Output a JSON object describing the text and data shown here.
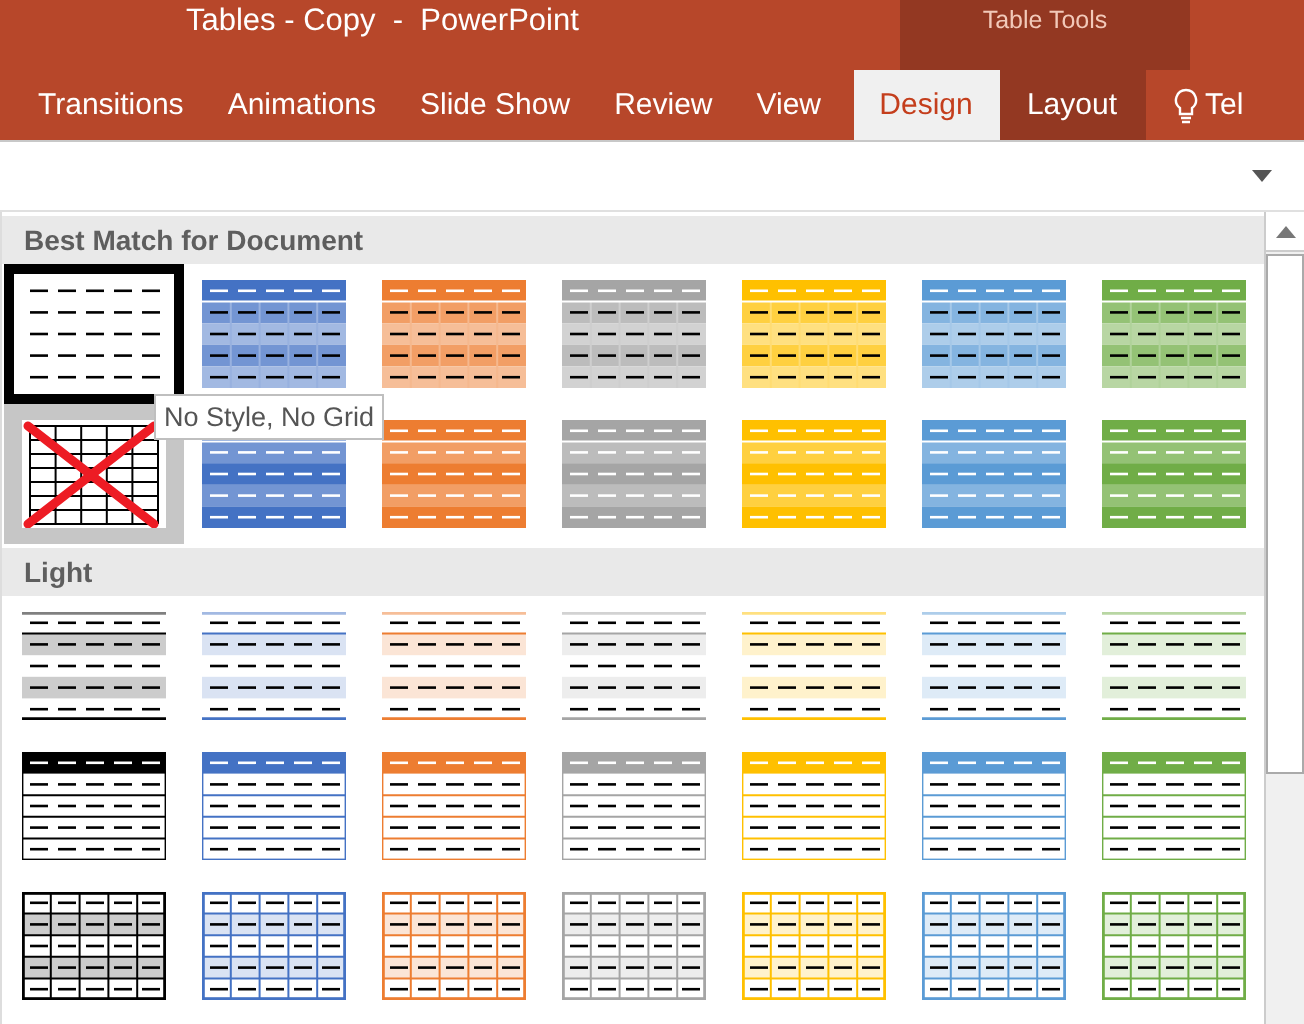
{
  "window": {
    "title": "Tables - Copy  -  PowerPoint"
  },
  "contextual_group": {
    "label": "Table Tools"
  },
  "tabs": [
    {
      "label": "Transitions",
      "selected": false,
      "contextual": false
    },
    {
      "label": "Animations",
      "selected": false,
      "contextual": false
    },
    {
      "label": "Slide Show",
      "selected": false,
      "contextual": false
    },
    {
      "label": "Review",
      "selected": false,
      "contextual": false
    },
    {
      "label": "View",
      "selected": false,
      "contextual": false
    },
    {
      "label": "Design",
      "selected": true,
      "contextual": true
    },
    {
      "label": "Layout",
      "selected": false,
      "contextual": true
    }
  ],
  "tell_me": {
    "label": "Tel"
  },
  "gallery": {
    "tooltip": "No Style, No Grid",
    "sections": [
      {
        "title": "Best Match for Document",
        "rows": [
          {
            "tiles": [
              {
                "kind": "plain",
                "selected": true
              },
              {
                "kind": "medium-grid",
                "color": "#4472c4",
                "selected": false
              },
              {
                "kind": "medium-grid",
                "color": "#ed7d31",
                "selected": false
              },
              {
                "kind": "medium-grid",
                "color": "#a5a5a5",
                "selected": false
              },
              {
                "kind": "medium-grid",
                "color": "#ffc000",
                "selected": false
              },
              {
                "kind": "medium-grid",
                "color": "#5b9bd5",
                "selected": false
              },
              {
                "kind": "medium-grid",
                "color": "#70ad47",
                "selected": false
              }
            ]
          },
          {
            "tiles": [
              {
                "kind": "clear",
                "selected": false
              },
              {
                "kind": "medium-band",
                "color": "#4472c4",
                "selected": false
              },
              {
                "kind": "medium-band",
                "color": "#ed7d31",
                "selected": false
              },
              {
                "kind": "medium-band",
                "color": "#a5a5a5",
                "selected": false
              },
              {
                "kind": "medium-band",
                "color": "#ffc000",
                "selected": false
              },
              {
                "kind": "medium-band",
                "color": "#5b9bd5",
                "selected": false
              },
              {
                "kind": "medium-band",
                "color": "#70ad47",
                "selected": false
              }
            ]
          }
        ]
      },
      {
        "title": "Light",
        "rows": [
          {
            "tiles": [
              {
                "kind": "light-band",
                "color": "#000000",
                "selected": false
              },
              {
                "kind": "light-band",
                "color": "#4472c4",
                "selected": false
              },
              {
                "kind": "light-band",
                "color": "#ed7d31",
                "selected": false
              },
              {
                "kind": "light-band",
                "color": "#a5a5a5",
                "selected": false
              },
              {
                "kind": "light-band",
                "color": "#ffc000",
                "selected": false
              },
              {
                "kind": "light-band",
                "color": "#5b9bd5",
                "selected": false
              },
              {
                "kind": "light-band",
                "color": "#70ad47",
                "selected": false
              }
            ]
          },
          {
            "tiles": [
              {
                "kind": "light-header",
                "color": "#000000",
                "selected": false
              },
              {
                "kind": "light-header",
                "color": "#4472c4",
                "selected": false
              },
              {
                "kind": "light-header",
                "color": "#ed7d31",
                "selected": false
              },
              {
                "kind": "light-header",
                "color": "#a5a5a5",
                "selected": false
              },
              {
                "kind": "light-header",
                "color": "#ffc000",
                "selected": false
              },
              {
                "kind": "light-header",
                "color": "#5b9bd5",
                "selected": false
              },
              {
                "kind": "light-header",
                "color": "#70ad47",
                "selected": false
              }
            ]
          },
          {
            "tiles": [
              {
                "kind": "light-grid",
                "color": "#000000",
                "selected": false
              },
              {
                "kind": "light-grid",
                "color": "#4472c4",
                "selected": false
              },
              {
                "kind": "light-grid",
                "color": "#ed7d31",
                "selected": false
              },
              {
                "kind": "light-grid",
                "color": "#a5a5a5",
                "selected": false
              },
              {
                "kind": "light-grid",
                "color": "#ffc000",
                "selected": false
              },
              {
                "kind": "light-grid",
                "color": "#5b9bd5",
                "selected": false
              },
              {
                "kind": "light-grid",
                "color": "#70ad47",
                "selected": false
              }
            ]
          }
        ]
      }
    ]
  }
}
